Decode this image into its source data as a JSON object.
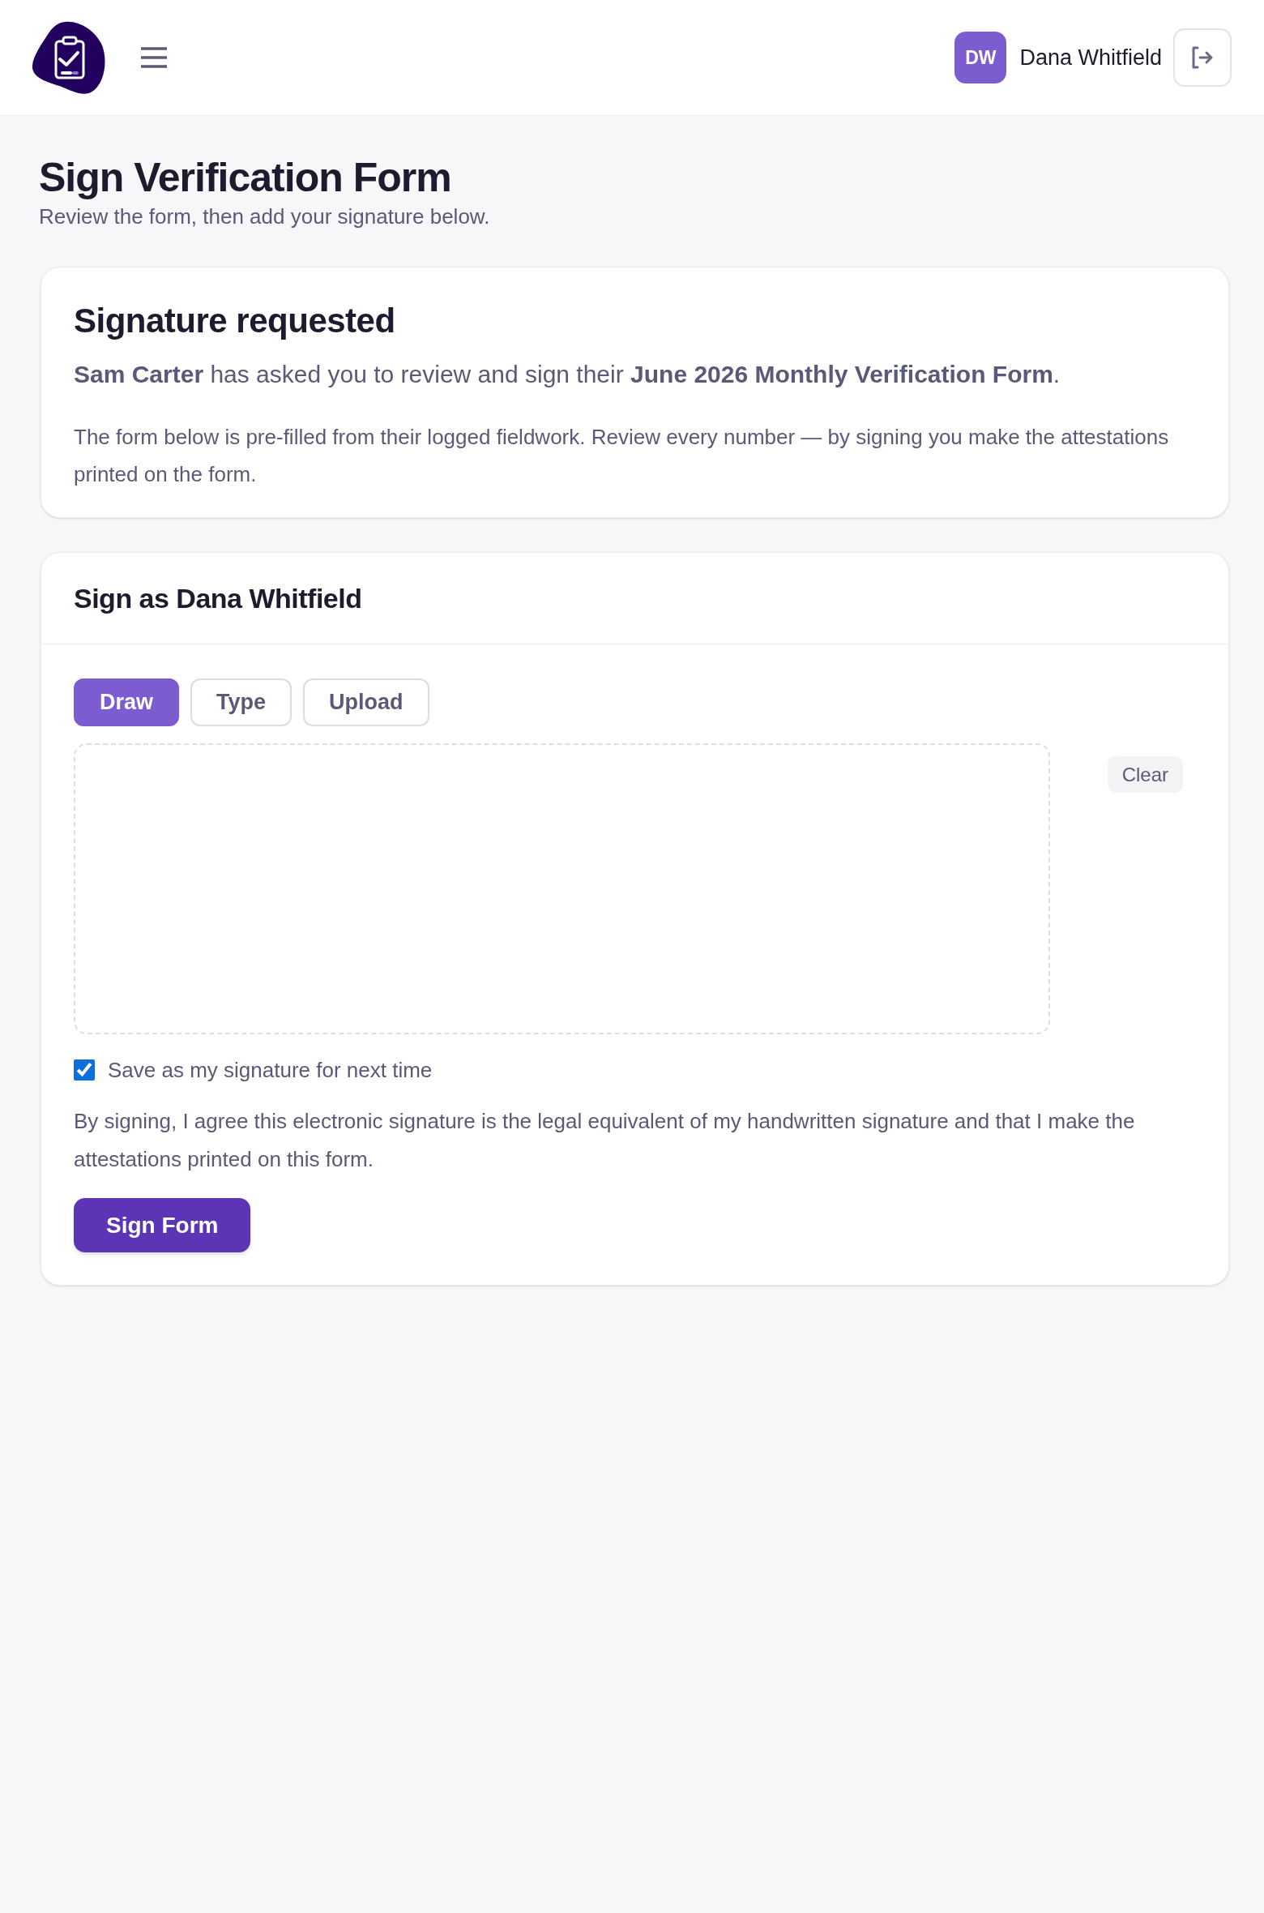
{
  "header": {
    "user": {
      "initials": "DW",
      "name": "Dana Whitfield"
    }
  },
  "page": {
    "title": "Sign Verification Form",
    "subtitle": "Review the form, then add your signature below."
  },
  "request_card": {
    "title": "Signature requested",
    "message": "**Sam Carter** has asked you to review and sign their **June 2026 Monthly Verification Form**.",
    "note": "The form below is pre-filled from their logged fieldwork. Review every number — by signing you make the attestations printed on the form."
  },
  "sign_card": {
    "title": "Sign as Dana Whitfield",
    "tabs": [
      {
        "label": "Draw",
        "selected": true
      },
      {
        "label": "Type",
        "selected": false
      },
      {
        "label": "Upload",
        "selected": false
      }
    ],
    "clear_label": "Clear",
    "save_signature": {
      "label": "Save as my signature for next time",
      "checked": true
    },
    "consent": "By signing, I agree this electronic signature is the legal equivalent of my handwritten signature and that I make the attestations printed on this form.",
    "submit_label": "Sign Form"
  }
}
